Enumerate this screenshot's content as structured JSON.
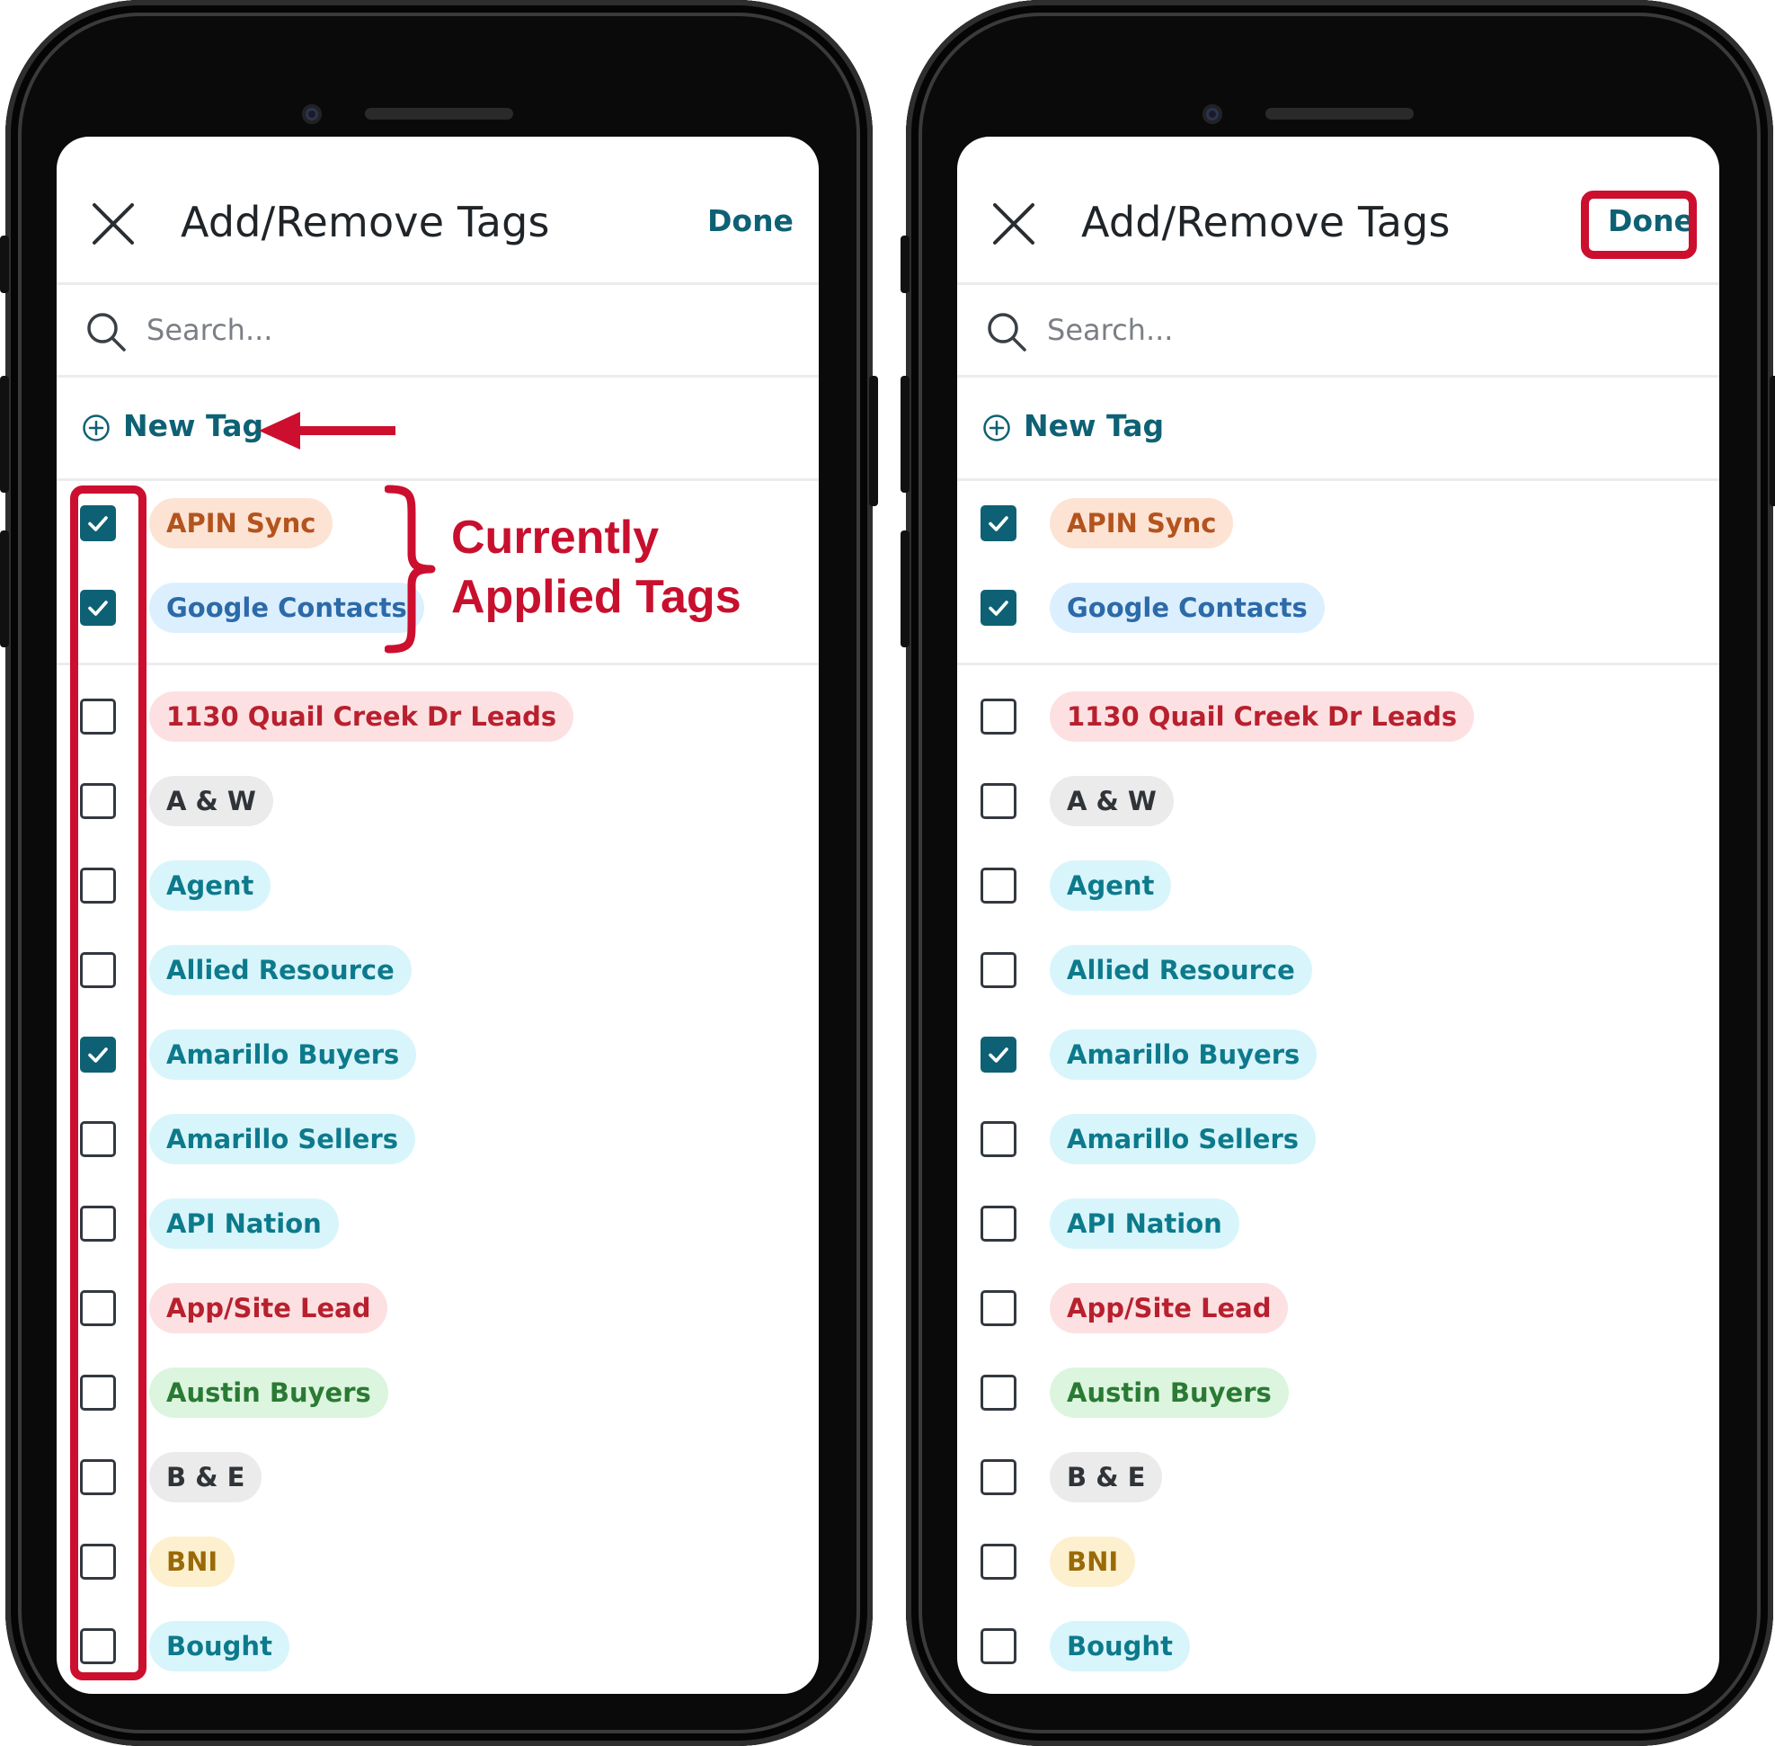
{
  "modal": {
    "title": "Add/Remove Tags",
    "done_label": "Done",
    "search_placeholder": "Search...",
    "new_tag_label": "New Tag"
  },
  "applied_tags": [
    {
      "label": "APIN Sync",
      "checked": true,
      "bg": "#fde3d4",
      "fg": "#b3541e"
    },
    {
      "label": "Google Contacts",
      "checked": true,
      "bg": "#dcefff",
      "fg": "#2c6aa8"
    }
  ],
  "tags": [
    {
      "label": "1130 Quail Creek Dr Leads",
      "checked": false,
      "bg": "#fde0e2",
      "fg": "#b8202e"
    },
    {
      "label": "A & W",
      "checked": false,
      "bg": "#ebebeb",
      "fg": "#303438"
    },
    {
      "label": "Agent",
      "checked": false,
      "bg": "#d8f5fb",
      "fg": "#0d7a8c"
    },
    {
      "label": "Allied Resource",
      "checked": false,
      "bg": "#d8f5fb",
      "fg": "#0d7a8c"
    },
    {
      "label": "Amarillo Buyers",
      "checked": true,
      "bg": "#d8f5fb",
      "fg": "#0d7a8c"
    },
    {
      "label": "Amarillo Sellers",
      "checked": false,
      "bg": "#d8f5fb",
      "fg": "#0d7a8c"
    },
    {
      "label": "API Nation",
      "checked": false,
      "bg": "#d8f5fb",
      "fg": "#0d7a8c"
    },
    {
      "label": "App/Site Lead",
      "checked": false,
      "bg": "#fde0e2",
      "fg": "#b8202e"
    },
    {
      "label": "Austin Buyers",
      "checked": false,
      "bg": "#dcf5de",
      "fg": "#2a7a34"
    },
    {
      "label": "B & E",
      "checked": false,
      "bg": "#ebebeb",
      "fg": "#303438"
    },
    {
      "label": "BNI",
      "checked": false,
      "bg": "#fdf0cf",
      "fg": "#9a6a08"
    },
    {
      "label": "Bought",
      "checked": false,
      "bg": "#d8f5fb",
      "fg": "#0d7a8c"
    }
  ],
  "annotation": {
    "line1": "Currently",
    "line2": "Applied Tags",
    "color": "#c8102e"
  }
}
